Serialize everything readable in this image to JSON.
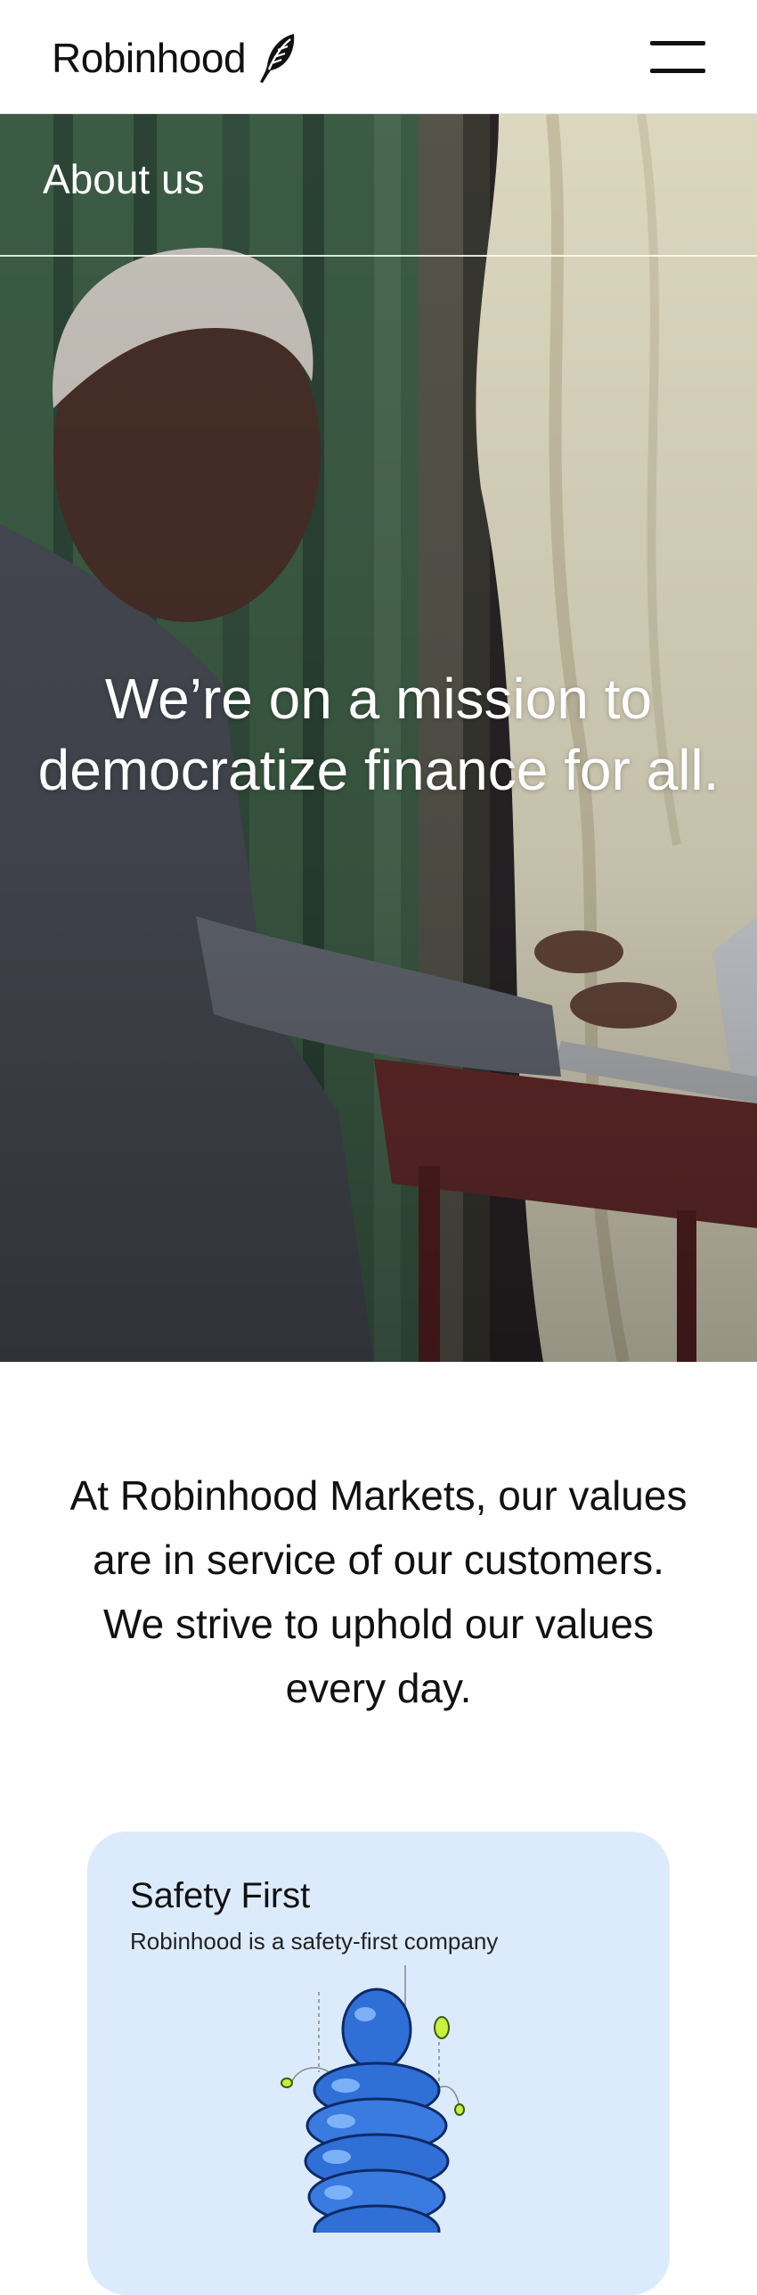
{
  "header": {
    "brand": "Robinhood",
    "logo_icon": "feather-icon",
    "menu_icon": "hamburger-menu-icon"
  },
  "hero": {
    "nav_label": "About us",
    "headline_line1": "We’re on a mission to",
    "headline_line2": "democratize finance for all."
  },
  "values_statement": {
    "line1": "At Robinhood Markets, our values",
    "line2": "are in service of our customers.",
    "line3": "We strive to uphold our values",
    "line4": "every day."
  },
  "cards": [
    {
      "title": "Safety First",
      "subtitle": "Robinhood is a safety-first company",
      "illustration": "blue-character-illustration"
    }
  ],
  "colors": {
    "card_background": "#dcebfc",
    "accent_blue": "#2f6fd6",
    "accent_green": "#c8f03c"
  }
}
